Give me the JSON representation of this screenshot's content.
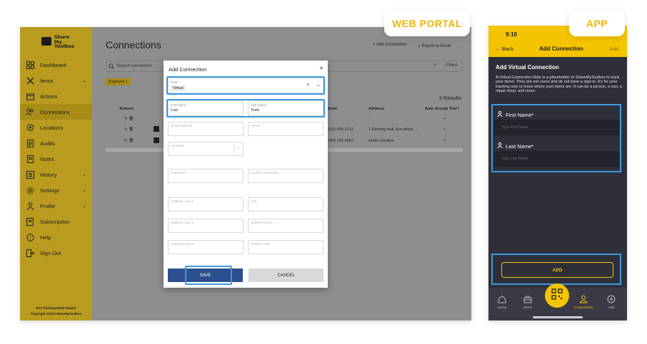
{
  "badges": {
    "web": "WEB PORTAL",
    "app": "APP"
  },
  "web": {
    "logo": {
      "line1": "Share",
      "line2": "My",
      "line3": "Toolbox"
    },
    "sidebar": {
      "items": [
        {
          "label": "Dashboard",
          "icon": "grid-icon"
        },
        {
          "label": "Items",
          "icon": "tools-icon",
          "expandable": true
        },
        {
          "label": "Actions",
          "icon": "actions-icon"
        },
        {
          "label": "Connections",
          "icon": "users-icon",
          "active": true
        },
        {
          "label": "Locations",
          "icon": "pin-icon"
        },
        {
          "label": "Audits",
          "icon": "clipboard-icon"
        },
        {
          "label": "Notes",
          "icon": "note-icon"
        },
        {
          "label": "History",
          "icon": "history-icon",
          "expandable": true
        },
        {
          "label": "Settings",
          "icon": "gear-icon",
          "expandable": true
        },
        {
          "label": "Profile",
          "icon": "person-icon",
          "expandable": true
        },
        {
          "label": "Subscription",
          "icon": "card-icon"
        },
        {
          "label": "Help",
          "icon": "help-icon"
        },
        {
          "label": "Sign Out",
          "icon": "signout-icon"
        }
      ],
      "footer1": "Tool Tracking Made Simple.",
      "footer2": "Copyright ©2023 ShareMyToolbox"
    },
    "title": "Connections",
    "add_connection": "+ Add Connection",
    "export": "Export to Excel",
    "search_placeholder": "Search connection",
    "filters": "Filters",
    "filter_chip": "Employee ×",
    "results": "3 Results",
    "columns": {
      "actions": "Actions",
      "phone": "hone",
      "address": "Address",
      "auto_accept": "Auto Accept Tool /"
    },
    "rows": [
      {
        "phone": "",
        "address": "-",
        "auto": "×"
      },
      {
        "phone": "212) 555-1212",
        "address": "1 Fleming Hall, Ann Arbor, ...",
        "auto": "×"
      },
      {
        "phone": "704) 202-3687",
        "address": "North Carolina",
        "auto": "×"
      }
    ],
    "modal": {
      "title": "Add Connection",
      "role_label": "Role *",
      "role_value": "Virtual",
      "first_name_label": "First name *",
      "first_name_value": "Lost",
      "last_name_label": "Last name *",
      "last_name_value": "Tools",
      "email": "Email address",
      "phone": "Phone",
      "location": "Location",
      "password": "Password",
      "confirm_password": "Confirm password",
      "address1": "Address Line 1",
      "city": "City",
      "address2": "Address Line 2",
      "state": "State/Province",
      "address3": "Address Line 3",
      "postal": "Postal Code",
      "save": "SAVE",
      "cancel": "CANCEL"
    }
  },
  "app": {
    "time": "9:10",
    "back": "Back",
    "title": "Add Connection",
    "add_top": "Add",
    "heading": "Add Virtual Connection",
    "description": "A Virtual Connection Role is a placeholder in ShareMyToolbox to track your items. They are not users and do not have a sign-in. It's for your tracking only to know where your items are. It can be a person, a van, a repair shop, and more.",
    "first_name_label": "First Name*",
    "first_name_placeholder": "Type First Name",
    "last_name_label": "Last Name*",
    "last_name_placeholder": "Type Last Name",
    "add_button": "ADD",
    "tabs": [
      {
        "label": "Home",
        "icon": "home-icon"
      },
      {
        "label": "Items",
        "icon": "toolbox-icon"
      },
      {
        "label": "",
        "icon": "qr-icon"
      },
      {
        "label": "Connections",
        "icon": "connections-icon"
      },
      {
        "label": "Add",
        "icon": "plus-icon"
      }
    ]
  }
}
